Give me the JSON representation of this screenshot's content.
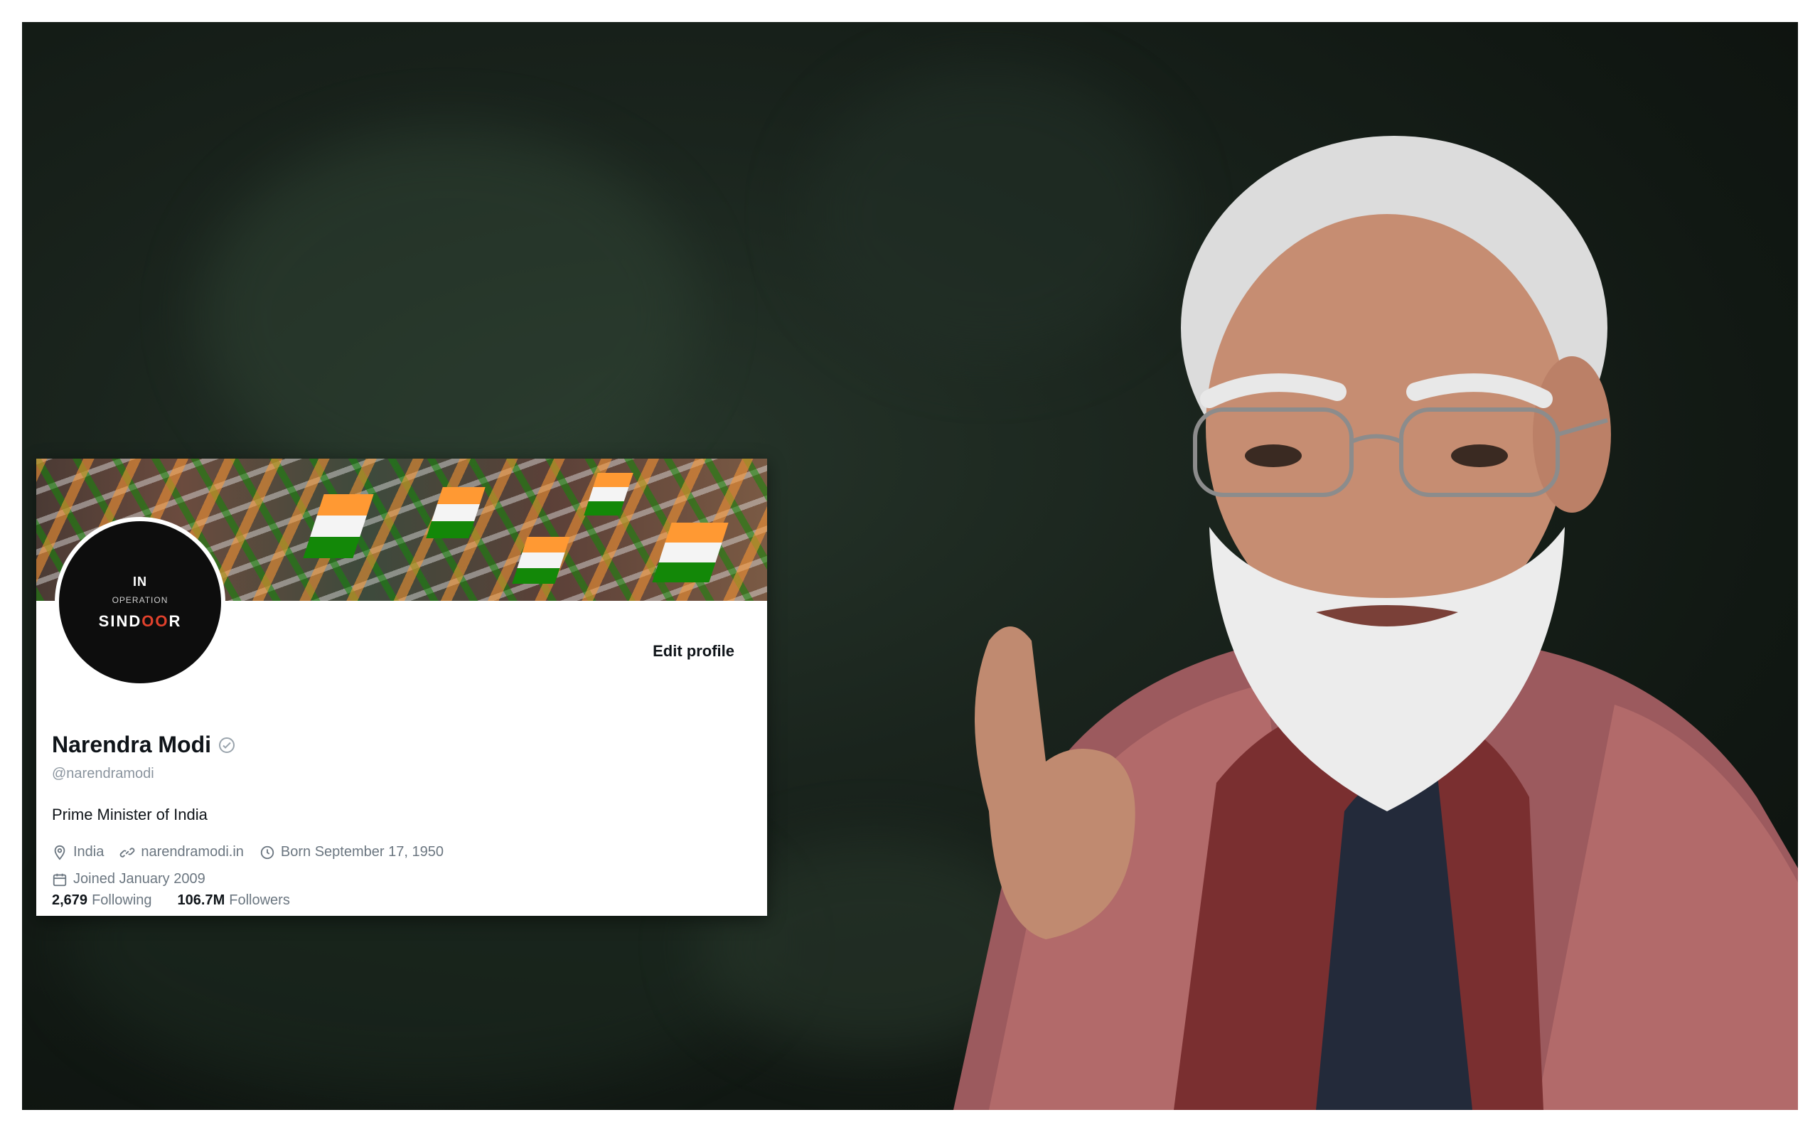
{
  "profile": {
    "avatar_line1": "IN",
    "avatar_line2": "OPERATION",
    "avatar_line3_a": "SIND",
    "avatar_line3_b": "OO",
    "avatar_line3_c": "R",
    "edit_label": "Edit profile",
    "name": "Narendra Modi",
    "handle": "@narendramodi",
    "bio": "Prime Minister of India",
    "location": "India",
    "website": "narendramodi.in",
    "born": "Born September 17, 1950",
    "joined": "Joined January 2009",
    "following_count": "2,679",
    "following_label": "Following",
    "followers_count": "106.7M",
    "followers_label": "Followers"
  },
  "icons": {
    "location": "location-pin-icon",
    "website": "link-icon",
    "born": "balloon-icon",
    "joined": "calendar-icon",
    "verified": "verified-badge-icon"
  },
  "colors": {
    "background": "#141c16",
    "card": "#ffffff",
    "text_primary": "#0f1419",
    "text_secondary": "#6b7680",
    "saffron": "#ff9933",
    "india_green": "#138808",
    "avatar_accent": "#e0412c"
  }
}
